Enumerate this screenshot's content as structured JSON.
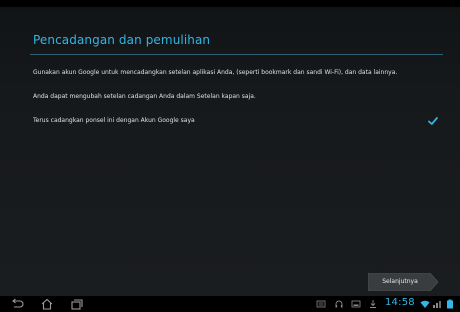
{
  "setup": {
    "title": "Pencadangan dan pemulihan",
    "paragraph_1": "Gunakan akun Google untuk mencadangkan setelan aplikasi Anda, (seperti bookmark dan sandi Wi-Fi), dan data lainnya.",
    "paragraph_2": "Anda dapat mengubah setelan cadangan Anda dalam Setelan kapan saja.",
    "backup_checkbox": {
      "label": "Terus cadangkan ponsel ini dengan Akun Google saya",
      "checked": true
    },
    "next_button_label": "Selanjutnya"
  },
  "navbar": {
    "icons": [
      "back-icon",
      "home-icon",
      "recent-apps-icon"
    ],
    "system_icons": [
      "keyboard-icon",
      "headset-icon",
      "screenshot-icon",
      "download-icon",
      "wifi-icon",
      "signal-icon",
      "battery-icon"
    ],
    "clock": "14:58"
  },
  "colors": {
    "accent": "#33b5e5",
    "background": "#16191b",
    "text": "#e0e0e0"
  }
}
